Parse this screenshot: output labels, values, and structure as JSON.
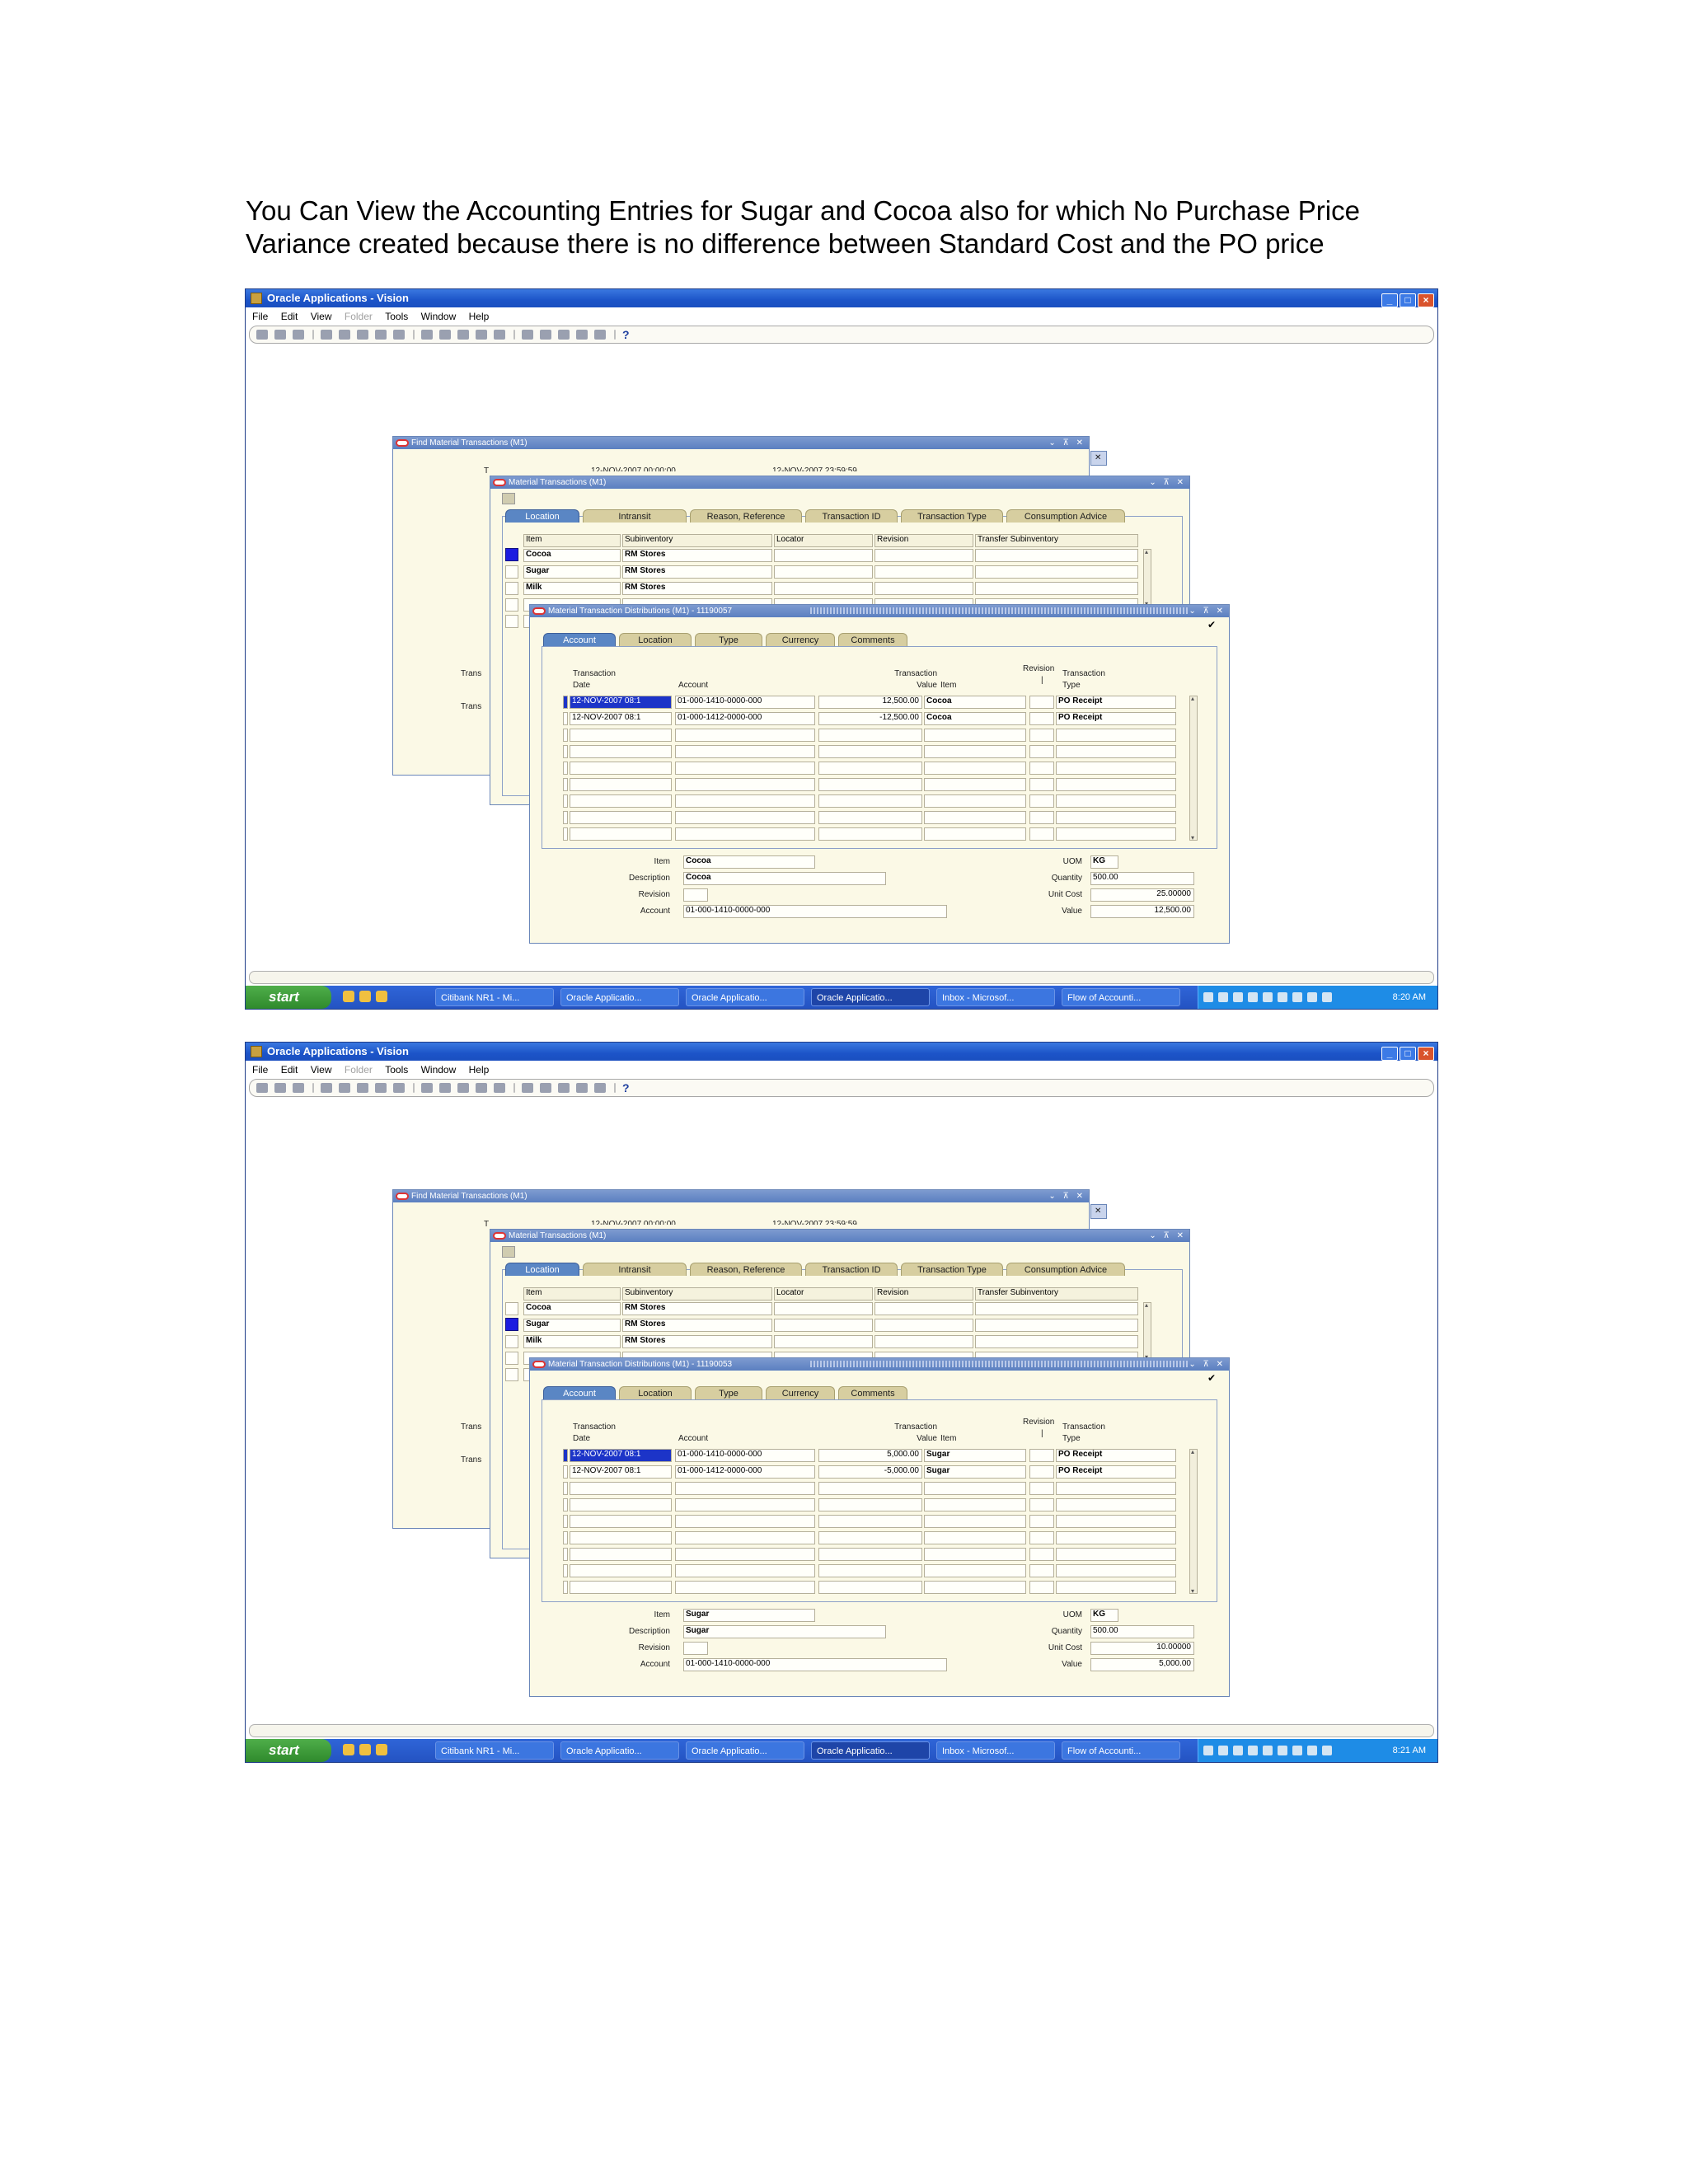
{
  "caption": {
    "line1": "You Can View the Accounting Entries for Sugar and Cocoa also for which No Purchase Price",
    "line2": "Variance created because there is no difference between Standard Cost and the PO price"
  },
  "app": {
    "title": "Oracle Applications - Vision",
    "menu": [
      "File",
      "Edit",
      "View",
      "Folder",
      "Tools",
      "Window",
      "Help"
    ],
    "folder_disabled": true
  },
  "find_window": {
    "title": "Find Material Transactions (M1)",
    "row_labels": [
      "Trans",
      "Trans"
    ],
    "partial_text_1": "12-NOV-2007 00:00:00",
    "partial_text_2": "12-NOV-2007 23:59:59"
  },
  "mt_window": {
    "title": "Material Transactions (M1)",
    "tabs": [
      "Location",
      "Intransit",
      "Reason, Reference",
      "Transaction ID",
      "Transaction Type",
      "Consumption Advice"
    ],
    "columns": [
      "Item",
      "Subinventory",
      "Locator",
      "Revision",
      "Transfer Subinventory"
    ],
    "rows": [
      {
        "item": "Cocoa",
        "subinventory": "RM Stores"
      },
      {
        "item": "Sugar",
        "subinventory": "RM Stores"
      },
      {
        "item": "Milk",
        "subinventory": "RM Stores"
      }
    ]
  },
  "dist_tabs": [
    "Account",
    "Location",
    "Type",
    "Currency",
    "Comments"
  ],
  "dist_headers": {
    "date_top": "Transaction",
    "date_bottom": "Date",
    "account": "Account",
    "value_top": "Transaction",
    "value_bottom": "Value",
    "item": "Item",
    "revision": "Revision",
    "type_top": "Transaction",
    "type_bottom": "Type"
  },
  "detail_labels": {
    "item": "Item",
    "description": "Description",
    "revision": "Revision",
    "account": "Account",
    "uom": "UOM",
    "quantity": "Quantity",
    "unit_cost": "Unit  Cost",
    "value": "Value"
  },
  "screens": [
    {
      "selected_row": 0,
      "dist_title": "Material Transaction Distributions (M1) - 11190057",
      "lines": [
        {
          "date": "12-NOV-2007 08:1",
          "account": "01-000-1410-0000-000",
          "value": "12,500.00",
          "item": "Cocoa",
          "type": "PO Receipt"
        },
        {
          "date": "12-NOV-2007 08:1",
          "account": "01-000-1412-0000-000",
          "value": "-12,500.00",
          "item": "Cocoa",
          "type": "PO Receipt"
        }
      ],
      "detail": {
        "item": "Cocoa",
        "description": "Cocoa",
        "account": "01-000-1410-0000-000",
        "uom": "KG",
        "quantity": "500.00",
        "unit_cost": "25.00000",
        "value": "12,500.00"
      },
      "clock": "8:20 AM"
    },
    {
      "selected_row": 1,
      "dist_title": "Material Transaction Distributions (M1) - 11190053",
      "lines": [
        {
          "date": "12-NOV-2007 08:1",
          "account": "01-000-1410-0000-000",
          "value": "5,000.00",
          "item": "Sugar",
          "type": "PO Receipt"
        },
        {
          "date": "12-NOV-2007 08:1",
          "account": "01-000-1412-0000-000",
          "value": "-5,000.00",
          "item": "Sugar",
          "type": "PO Receipt"
        }
      ],
      "detail": {
        "item": "Sugar",
        "description": "Sugar",
        "account": "01-000-1410-0000-000",
        "uom": "KG",
        "quantity": "500.00",
        "unit_cost": "10.00000",
        "value": "5,000.00"
      },
      "clock": "8:21 AM"
    }
  ],
  "taskbar": {
    "start": "start",
    "tasks": [
      "Citibank NR1 - Mi...",
      "Oracle Applicatio...",
      "Oracle Applicatio...",
      "Oracle Applicatio...",
      "Inbox - Microsof...",
      "Flow of Accounti..."
    ],
    "active_task": 3
  },
  "colors": {
    "xp_title": "#1c54c8",
    "form_bg": "#fbf9e6",
    "active_tab": "#5a86c4",
    "selection": "#1c34c8",
    "tab": "#d7cea0"
  }
}
